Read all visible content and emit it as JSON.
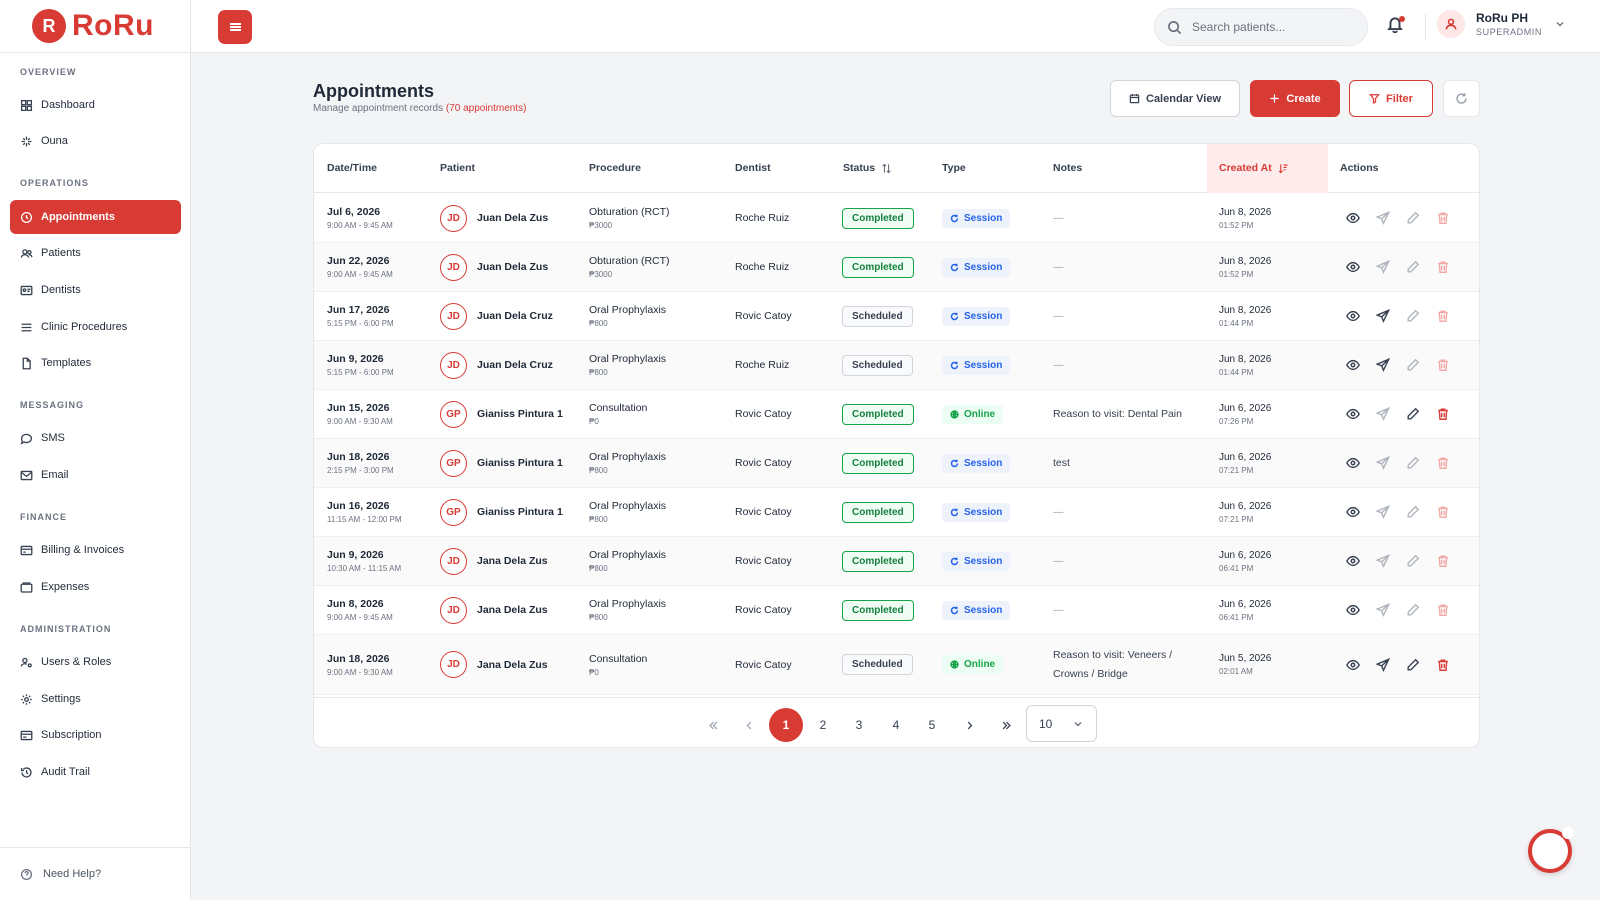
{
  "brand": {
    "name": "RoRu",
    "mark": "R",
    "color": "#d83a34"
  },
  "sidebar": {
    "sections": [
      "OVERVIEW",
      "OPERATIONS",
      "MESSAGING",
      "FINANCE",
      "ADMINISTRATION"
    ],
    "items": [
      {
        "label": "Dashboard",
        "icon": "grid-icon"
      },
      {
        "label": "Ouna",
        "icon": "sparkle-icon"
      },
      {
        "label": "Appointments",
        "icon": "clock-icon",
        "active": true
      },
      {
        "label": "Patients",
        "icon": "users-icon"
      },
      {
        "label": "Dentists",
        "icon": "id-card-icon"
      },
      {
        "label": "Clinic Procedures",
        "icon": "list-icon"
      },
      {
        "label": "Templates",
        "icon": "file-icon"
      },
      {
        "label": "SMS",
        "icon": "chat-icon"
      },
      {
        "label": "Email",
        "icon": "mail-icon"
      },
      {
        "label": "Billing & Invoices",
        "icon": "receipt-icon"
      },
      {
        "label": "Expenses",
        "icon": "wallet-icon"
      },
      {
        "label": "Users & Roles",
        "icon": "user-cog-icon"
      },
      {
        "label": "Settings",
        "icon": "gear-icon"
      },
      {
        "label": "Subscription",
        "icon": "card-icon"
      },
      {
        "label": "Audit Trail",
        "icon": "history-icon"
      }
    ],
    "help": "Need Help?"
  },
  "topbar": {
    "search_placeholder": "Search patients...",
    "user_name": "RoRu PH",
    "user_role": "SUPERADMIN"
  },
  "page": {
    "title": "Appointments",
    "subtitle": "Manage appointment records",
    "count": "(70 appointments)",
    "buttons": {
      "calendar": "Calendar View",
      "create": "Create",
      "filter": "Filter"
    }
  },
  "table": {
    "columns": [
      "Date/Time",
      "Patient",
      "Procedure",
      "Dentist",
      "Status",
      "Type",
      "Notes",
      "Created At",
      "Actions"
    ],
    "rows": [
      {
        "date": "Jul 6, 2026",
        "time": "9:00 AM - 9:45 AM",
        "initials": "JD",
        "patient": "Juan Dela Zus",
        "procedure": "Obturation (RCT)",
        "price": "₱3000",
        "dentist": "Roche Ruiz",
        "status": "Completed",
        "type": "Session",
        "notes": "—",
        "created_date": "Jun 8, 2026",
        "created_time": "01:52 PM"
      },
      {
        "date": "Jun 22, 2026",
        "time": "9:00 AM - 9:45 AM",
        "initials": "JD",
        "patient": "Juan Dela Zus",
        "procedure": "Obturation (RCT)",
        "price": "₱3000",
        "dentist": "Roche Ruiz",
        "status": "Completed",
        "type": "Session",
        "notes": "—",
        "created_date": "Jun 8, 2026",
        "created_time": "01:52 PM"
      },
      {
        "date": "Jun 17, 2026",
        "time": "5:15 PM - 6:00 PM",
        "initials": "JD",
        "patient": "Juan Dela Cruz",
        "procedure": "Oral Prophylaxis",
        "price": "₱800",
        "dentist": "Rovic Catoy",
        "status": "Scheduled",
        "type": "Session",
        "notes": "—",
        "created_date": "Jun 8, 2026",
        "created_time": "01:44 PM"
      },
      {
        "date": "Jun 9, 2026",
        "time": "5:15 PM - 6:00 PM",
        "initials": "JD",
        "patient": "Juan Dela Cruz",
        "procedure": "Oral Prophylaxis",
        "price": "₱800",
        "dentist": "Roche Ruiz",
        "status": "Scheduled",
        "type": "Session",
        "notes": "—",
        "created_date": "Jun 8, 2026",
        "created_time": "01:44 PM"
      },
      {
        "date": "Jun 15, 2026",
        "time": "9:00 AM - 9:30 AM",
        "initials": "GP",
        "patient": "Gianiss Pintura 1",
        "procedure": "Consultation",
        "price": "₱0",
        "dentist": "Rovic Catoy",
        "status": "Completed",
        "type": "Online",
        "notes": "Reason to visit: Dental Pain",
        "created_date": "Jun 6, 2026",
        "created_time": "07:26 PM"
      },
      {
        "date": "Jun 18, 2026",
        "time": "2:15 PM - 3:00 PM",
        "initials": "GP",
        "patient": "Gianiss Pintura 1",
        "procedure": "Oral Prophylaxis",
        "price": "₱800",
        "dentist": "Rovic Catoy",
        "status": "Completed",
        "type": "Session",
        "notes": "test",
        "created_date": "Jun 6, 2026",
        "created_time": "07:21 PM"
      },
      {
        "date": "Jun 16, 2026",
        "time": "11:15 AM - 12:00 PM",
        "initials": "GP",
        "patient": "Gianiss Pintura 1",
        "procedure": "Oral Prophylaxis",
        "price": "₱800",
        "dentist": "Rovic Catoy",
        "status": "Completed",
        "type": "Session",
        "notes": "—",
        "created_date": "Jun 6, 2026",
        "created_time": "07:21 PM"
      },
      {
        "date": "Jun 9, 2026",
        "time": "10:30 AM - 11:15 AM",
        "initials": "JD",
        "patient": "Jana Dela Zus",
        "procedure": "Oral Prophylaxis",
        "price": "₱800",
        "dentist": "Rovic Catoy",
        "status": "Completed",
        "type": "Session",
        "notes": "—",
        "created_date": "Jun 6, 2026",
        "created_time": "06:41 PM"
      },
      {
        "date": "Jun 8, 2026",
        "time": "9:00 AM - 9:45 AM",
        "initials": "JD",
        "patient": "Jana Dela Zus",
        "procedure": "Oral Prophylaxis",
        "price": "₱800",
        "dentist": "Rovic Catoy",
        "status": "Completed",
        "type": "Session",
        "notes": "—",
        "created_date": "Jun 6, 2026",
        "created_time": "06:41 PM"
      },
      {
        "date": "Jun 18, 2026",
        "time": "9:00 AM - 9:30 AM",
        "initials": "JD",
        "patient": "Jana Dela Zus",
        "procedure": "Consultation",
        "price": "₱0",
        "dentist": "Rovic Catoy",
        "status": "Scheduled",
        "type": "Online",
        "notes": "Reason to visit: Veneers / Crowns / Bridge",
        "created_date": "Jun 5, 2026",
        "created_time": "02:01 AM"
      }
    ]
  },
  "pagination": {
    "pages": [
      "1",
      "2",
      "3",
      "4",
      "5"
    ],
    "current": "1",
    "page_size": "10"
  }
}
